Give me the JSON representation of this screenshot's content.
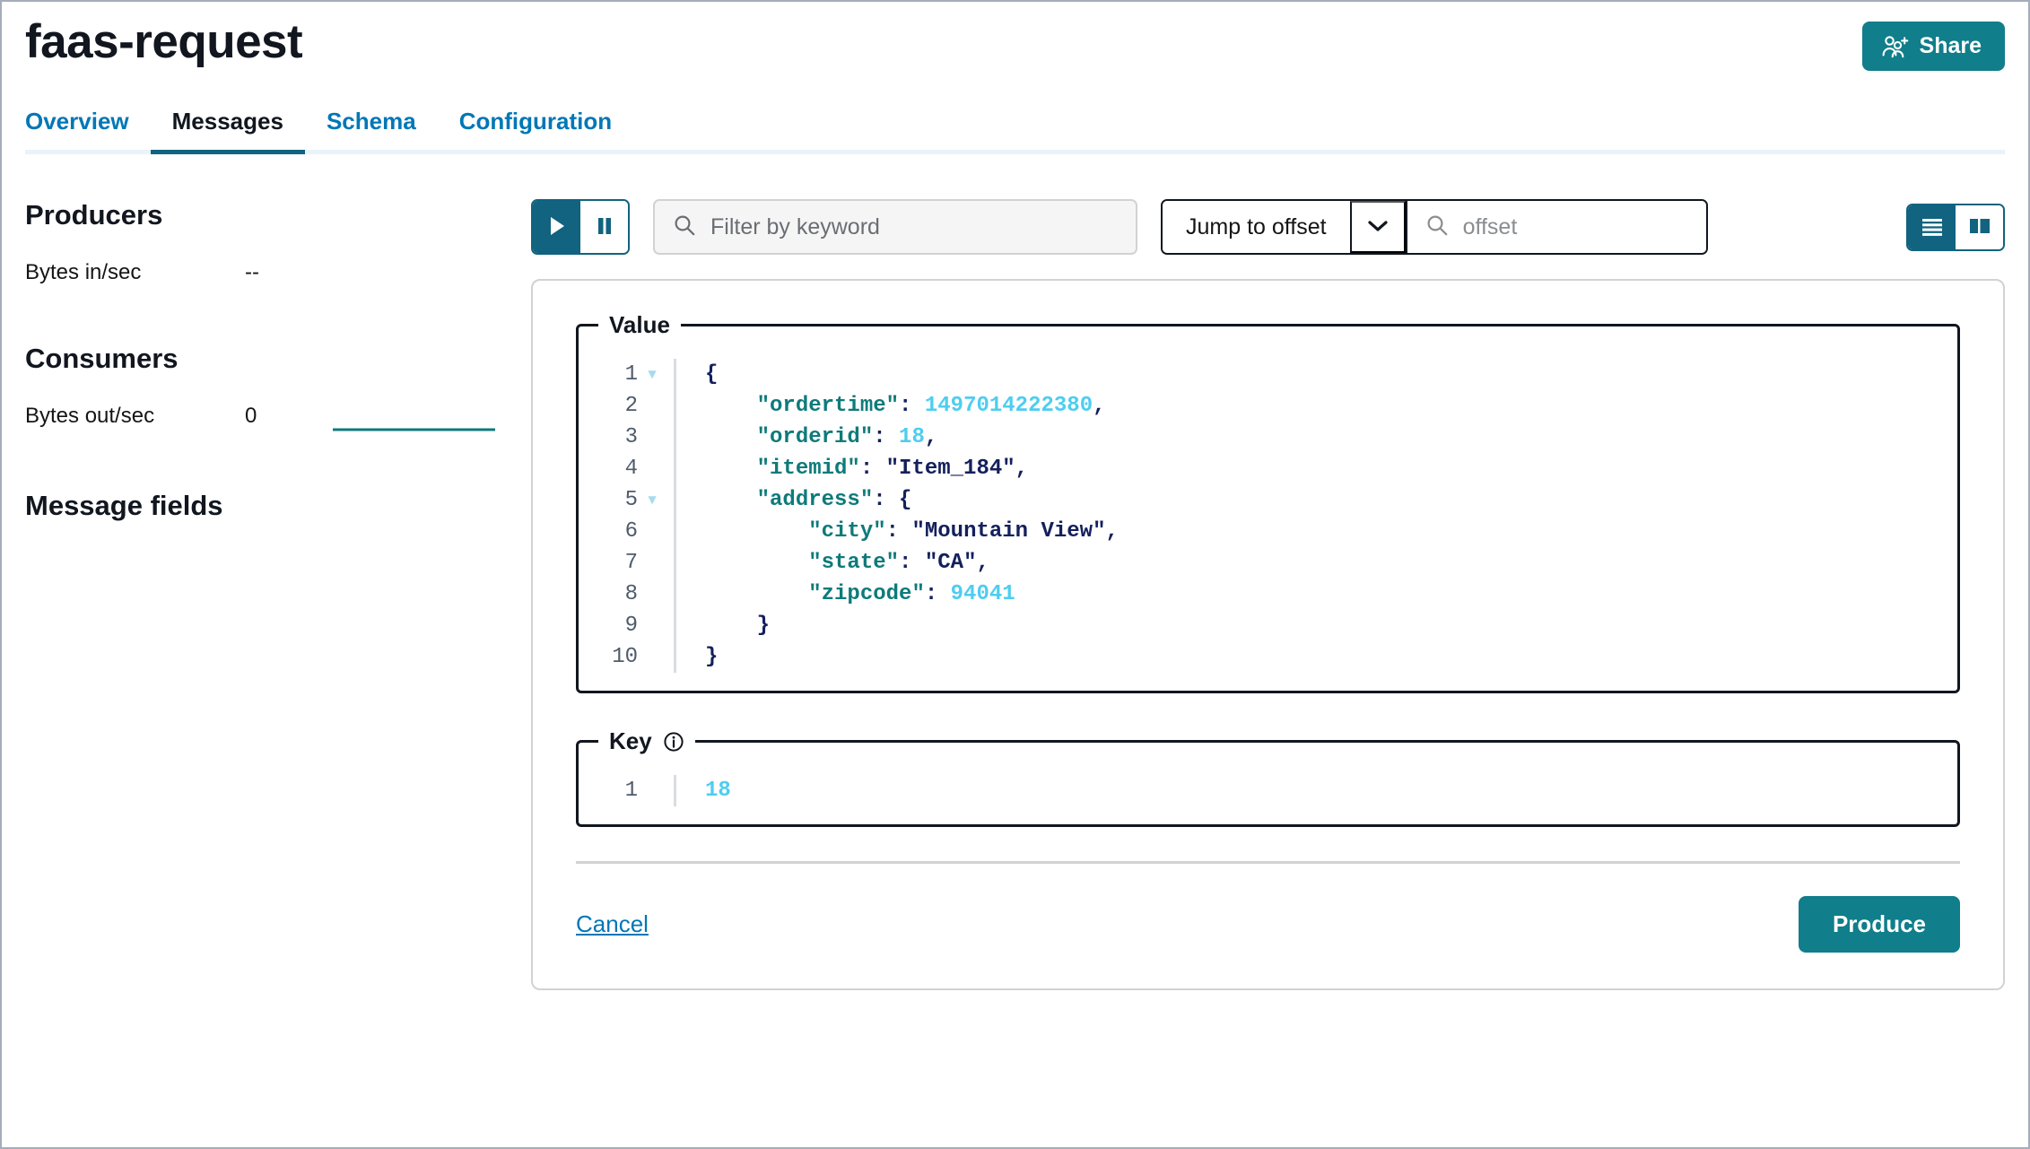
{
  "header": {
    "title": "faas-request",
    "share_label": "Share",
    "share_icon": "users-plus-icon",
    "accent_color": "#107e8b"
  },
  "tabs": [
    {
      "label": "Overview",
      "active": false
    },
    {
      "label": "Messages",
      "active": true
    },
    {
      "label": "Schema",
      "active": false
    },
    {
      "label": "Configuration",
      "active": false
    }
  ],
  "sidebar": {
    "producers": {
      "heading": "Producers",
      "metric_label": "Bytes in/sec",
      "metric_value": "--"
    },
    "consumers": {
      "heading": "Consumers",
      "metric_label": "Bytes out/sec",
      "metric_value": "0",
      "sparkline_color": "#0f7a7a"
    },
    "message_fields": {
      "heading": "Message fields"
    }
  },
  "toolbar": {
    "play_icon": "play-icon",
    "pause_icon": "pause-icon",
    "play_active": true,
    "filter": {
      "icon": "search-icon",
      "placeholder": "Filter by keyword",
      "value": ""
    },
    "jump": {
      "label": "Jump to offset",
      "caret_icon": "chevron-down-icon"
    },
    "offset": {
      "icon": "search-icon",
      "placeholder": "offset",
      "value": ""
    },
    "view_list_icon": "list-view-icon",
    "view_card_icon": "column-view-icon",
    "view_list_active": true,
    "active_color": "#11637f"
  },
  "detail": {
    "value_legend": "Value",
    "key_legend": "Key",
    "key_info_icon": "info-circle-icon",
    "value_lines": [
      {
        "no": "1",
        "fold": true,
        "tokens": [
          {
            "t": "{",
            "c": "b"
          }
        ]
      },
      {
        "no": "2",
        "fold": false,
        "tokens": [
          {
            "t": "    ",
            "c": ""
          },
          {
            "t": "\"ordertime\"",
            "c": "k"
          },
          {
            "t": ": ",
            "c": "p"
          },
          {
            "t": "1497014222380",
            "c": "n"
          },
          {
            "t": ",",
            "c": "p"
          }
        ]
      },
      {
        "no": "3",
        "fold": false,
        "tokens": [
          {
            "t": "    ",
            "c": ""
          },
          {
            "t": "\"orderid\"",
            "c": "k"
          },
          {
            "t": ": ",
            "c": "p"
          },
          {
            "t": "18",
            "c": "n"
          },
          {
            "t": ",",
            "c": "p"
          }
        ]
      },
      {
        "no": "4",
        "fold": false,
        "tokens": [
          {
            "t": "    ",
            "c": ""
          },
          {
            "t": "\"itemid\"",
            "c": "k"
          },
          {
            "t": ": ",
            "c": "p"
          },
          {
            "t": "\"Item_184\"",
            "c": "s"
          },
          {
            "t": ",",
            "c": "p"
          }
        ]
      },
      {
        "no": "5",
        "fold": true,
        "tokens": [
          {
            "t": "    ",
            "c": ""
          },
          {
            "t": "\"address\"",
            "c": "k"
          },
          {
            "t": ": ",
            "c": "p"
          },
          {
            "t": "{",
            "c": "b"
          }
        ]
      },
      {
        "no": "6",
        "fold": false,
        "tokens": [
          {
            "t": "        ",
            "c": ""
          },
          {
            "t": "\"city\"",
            "c": "k"
          },
          {
            "t": ": ",
            "c": "p"
          },
          {
            "t": "\"Mountain View\"",
            "c": "s"
          },
          {
            "t": ",",
            "c": "p"
          }
        ]
      },
      {
        "no": "7",
        "fold": false,
        "tokens": [
          {
            "t": "        ",
            "c": ""
          },
          {
            "t": "\"state\"",
            "c": "k"
          },
          {
            "t": ": ",
            "c": "p"
          },
          {
            "t": "\"CA\"",
            "c": "s"
          },
          {
            "t": ",",
            "c": "p"
          }
        ]
      },
      {
        "no": "8",
        "fold": false,
        "tokens": [
          {
            "t": "        ",
            "c": ""
          },
          {
            "t": "\"zipcode\"",
            "c": "k"
          },
          {
            "t": ": ",
            "c": "p"
          },
          {
            "t": "94041",
            "c": "n"
          }
        ]
      },
      {
        "no": "9",
        "fold": false,
        "tokens": [
          {
            "t": "    ",
            "c": ""
          },
          {
            "t": "}",
            "c": "b"
          }
        ]
      },
      {
        "no": "10",
        "fold": false,
        "tokens": [
          {
            "t": "}",
            "c": "b"
          }
        ]
      }
    ],
    "key_lines": [
      {
        "no": "1",
        "fold": false,
        "tokens": [
          {
            "t": "18",
            "c": "n"
          }
        ]
      }
    ],
    "cancel_label": "Cancel",
    "produce_label": "Produce"
  }
}
